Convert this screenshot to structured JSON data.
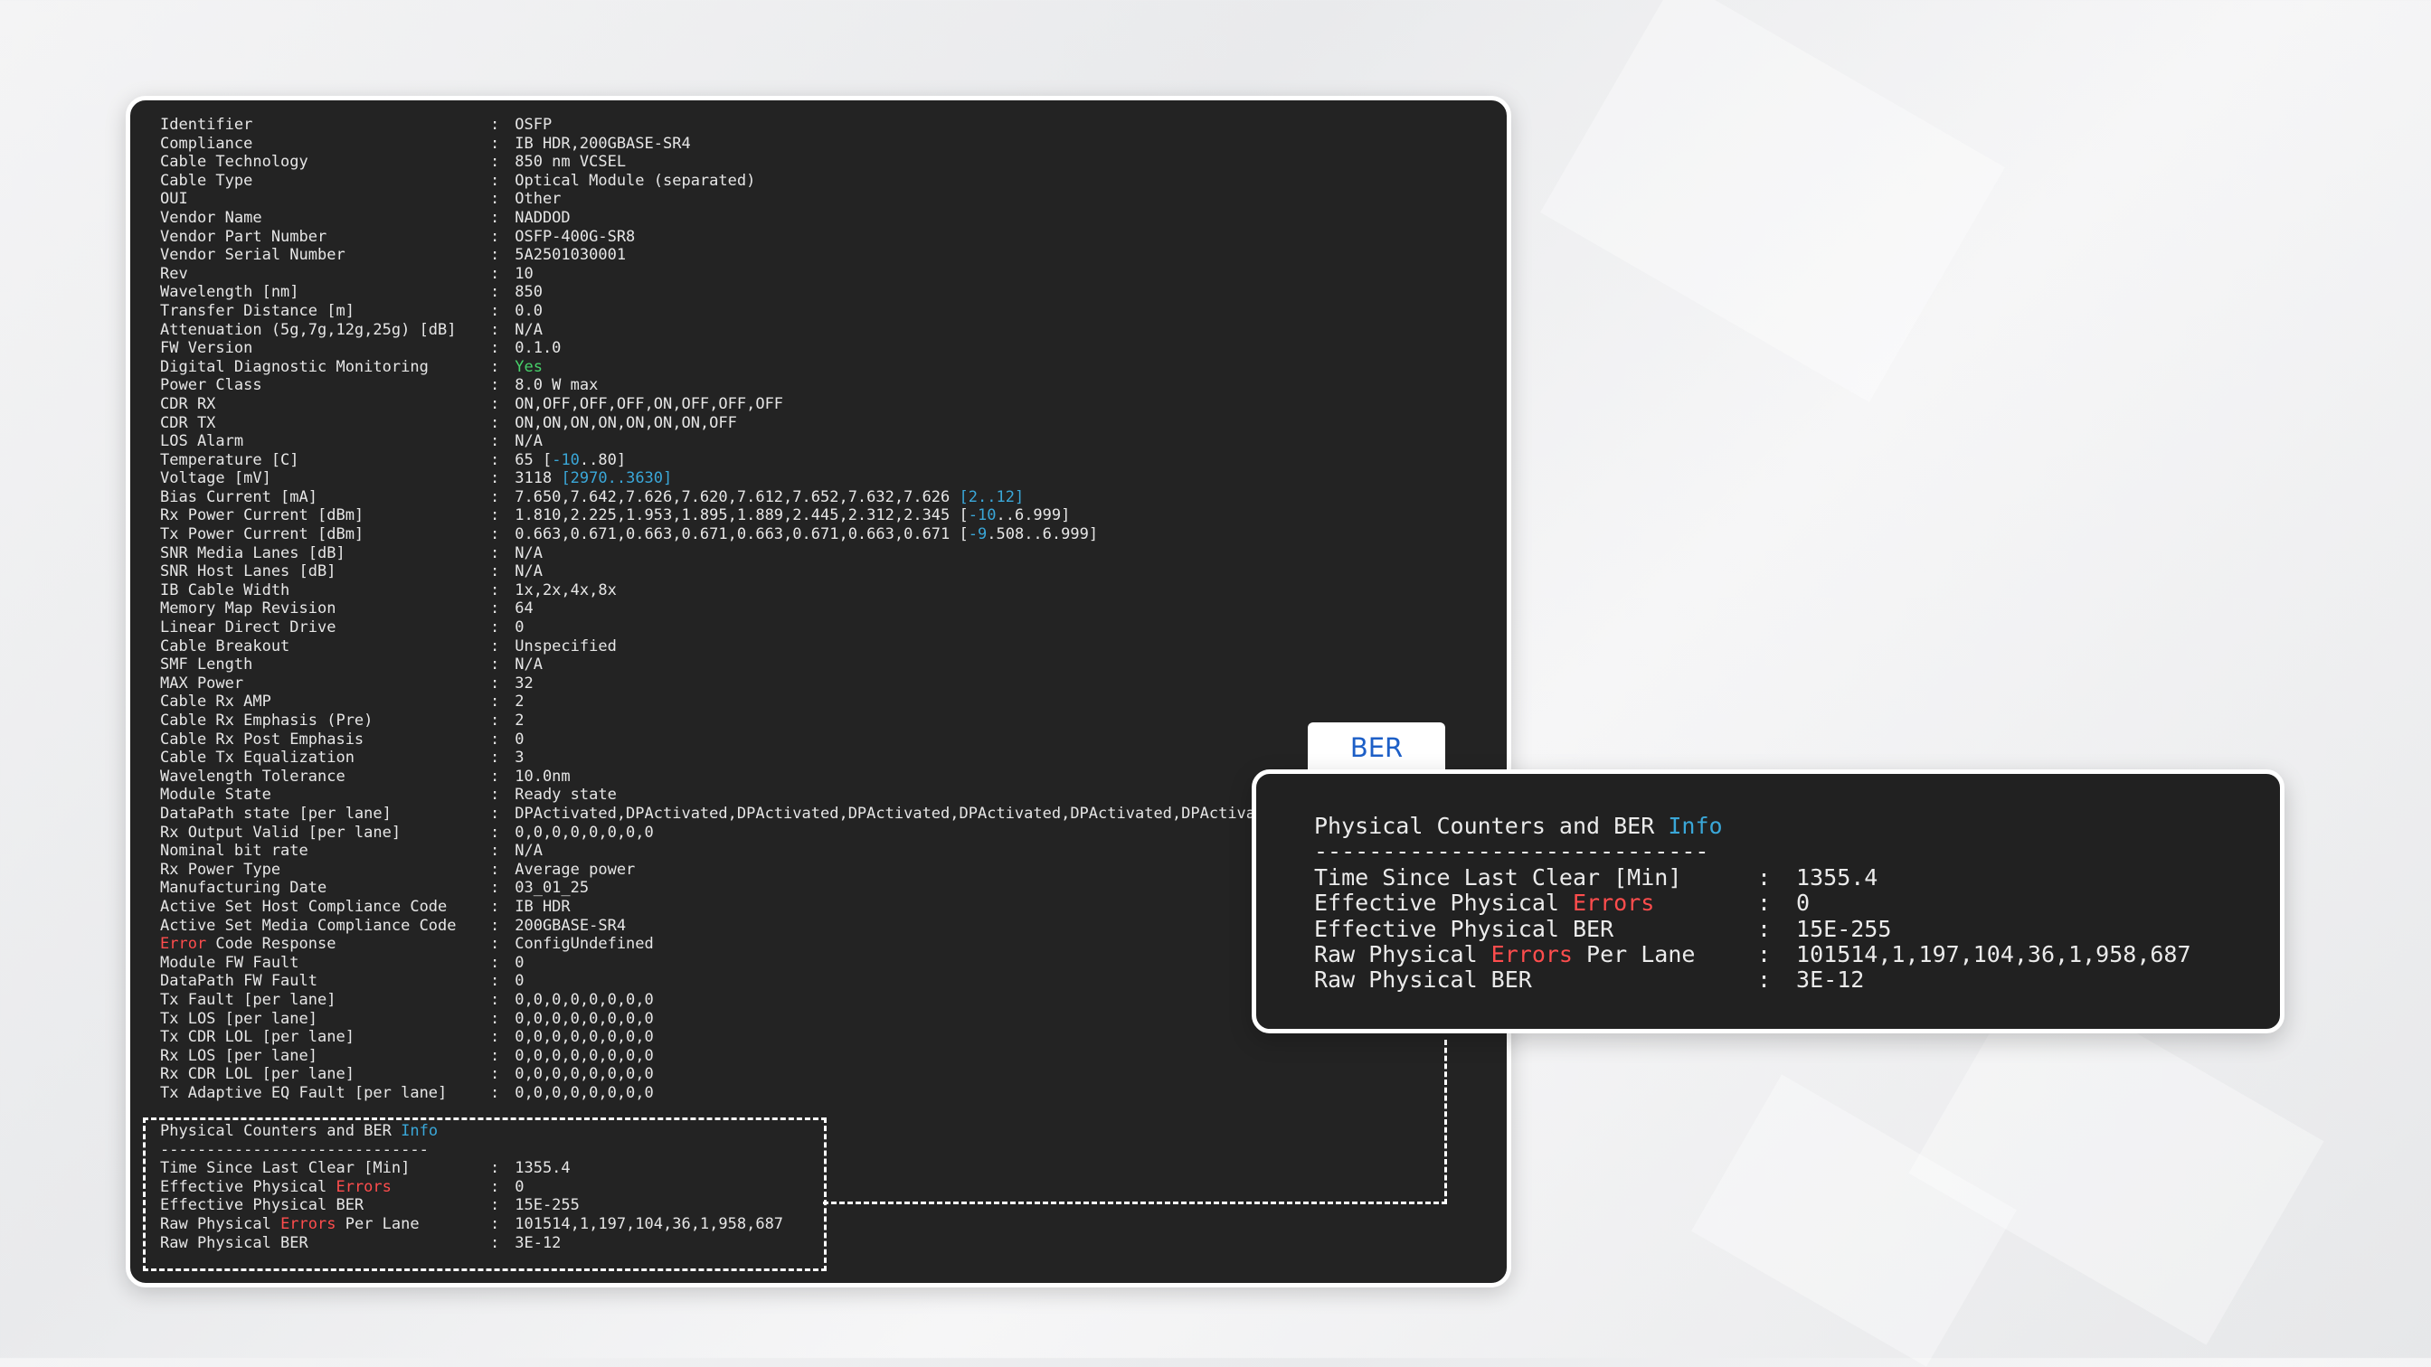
{
  "terminal": {
    "rows": [
      {
        "k": "Identifier",
        "v": "OSFP"
      },
      {
        "k": "Compliance",
        "v": "IB HDR,200GBASE-SR4"
      },
      {
        "k": "Cable Technology",
        "v": "850 nm VCSEL"
      },
      {
        "k": "Cable Type",
        "v": "Optical Module (separated)"
      },
      {
        "k": "OUI",
        "v": "Other"
      },
      {
        "k": "Vendor Name",
        "v": "NADDOD"
      },
      {
        "k": "Vendor Part Number",
        "v": "OSFP-400G-SR8"
      },
      {
        "k": "Vendor Serial Number",
        "v": "5A2501030001"
      },
      {
        "k": "Rev",
        "v": "10"
      },
      {
        "k": "Wavelength [nm]",
        "v": "850"
      },
      {
        "k": "Transfer Distance [m]",
        "v": "0.0"
      },
      {
        "k": "Attenuation (5g,7g,12g,25g) [dB]",
        "v": "N/A"
      },
      {
        "k": "FW Version",
        "v": "0.1.0"
      },
      {
        "k": "Digital Diagnostic Monitoring",
        "v": "Yes"
      },
      {
        "k": "Power Class",
        "v": "8.0 W max"
      },
      {
        "k": "CDR RX",
        "v": "ON,OFF,OFF,OFF,ON,OFF,OFF,OFF"
      },
      {
        "k": "CDR TX",
        "v": "ON,ON,ON,ON,ON,ON,ON,OFF"
      },
      {
        "k": "LOS Alarm",
        "v": "N/A"
      },
      {
        "k": "Temperature [C]",
        "v": "65",
        "r1": "[",
        "r2": "-10",
        "r3": "..80]"
      },
      {
        "k": "Voltage [mV]",
        "v": "3118",
        "rng": "[2970..3630]"
      },
      {
        "k": "Bias Current [mA]",
        "v": "7.650,7.642,7.626,7.620,7.612,7.652,7.632,7.626",
        "rng": "[2..12]"
      },
      {
        "k": "Rx Power Current [dBm]",
        "v": "1.810,2.225,1.953,1.895,1.889,2.445,2.312,2.345",
        "r1": "[",
        "r2": "-10",
        "r3": "..6.999]"
      },
      {
        "k": "Tx Power Current [dBm]",
        "v": "0.663,0.671,0.663,0.671,0.663,0.671,0.663,0.671",
        "r1": "[",
        "r2": "-9",
        "r3": ".508..6.999]"
      },
      {
        "k": "SNR Media Lanes [dB]",
        "v": "N/A"
      },
      {
        "k": "SNR Host Lanes [dB]",
        "v": "N/A"
      },
      {
        "k": "IB Cable Width",
        "v": "1x,2x,4x,8x"
      },
      {
        "k": "Memory Map Revision",
        "v": "64"
      },
      {
        "k": "Linear Direct Drive",
        "v": "0"
      },
      {
        "k": "Cable Breakout",
        "v": "Unspecified"
      },
      {
        "k": "SMF Length",
        "v": "N/A"
      },
      {
        "k": "MAX Power",
        "v": "32"
      },
      {
        "k": "Cable Rx AMP",
        "v": "2"
      },
      {
        "k": "Cable Rx Emphasis (Pre)",
        "v": "2"
      },
      {
        "k": "Cable Rx Post Emphasis",
        "v": "0"
      },
      {
        "k": "Cable Tx Equalization",
        "v": "3"
      },
      {
        "k": "Wavelength Tolerance",
        "v": "10.0nm"
      },
      {
        "k": "Module State",
        "v": "Ready state"
      },
      {
        "k": "DataPath state [per lane]",
        "v": "DPActivated,DPActivated,DPActivated,DPActivated,DPActivated,DPActivated,DPActivat"
      },
      {
        "k": "Rx Output Valid [per lane]",
        "v": "0,0,0,0,0,0,0,0"
      },
      {
        "k": "Nominal bit rate",
        "v": "N/A"
      },
      {
        "k": "Rx Power Type",
        "v": "Average power"
      },
      {
        "k": "Manufacturing Date",
        "v": "03_01_25"
      },
      {
        "k": "Active Set Host Compliance Code",
        "v": "IB HDR"
      },
      {
        "k": "Active Set Media Compliance Code",
        "v": "200GBASE-SR4"
      },
      {
        "kRed": "Error",
        "kRest": " Code Response",
        "v": "ConfigUndefined"
      },
      {
        "k": "Module FW Fault",
        "v": "0"
      },
      {
        "k": "DataPath FW Fault",
        "v": "0"
      },
      {
        "k": "Tx Fault [per lane]",
        "v": "0,0,0,0,0,0,0,0"
      },
      {
        "k": "Tx LOS [per lane]",
        "v": "0,0,0,0,0,0,0,0"
      },
      {
        "k": "Tx CDR LOL [per lane]",
        "v": "0,0,0,0,0,0,0,0"
      },
      {
        "k": "Rx LOS [per lane]",
        "v": "0,0,0,0,0,0,0,0"
      },
      {
        "k": "Rx CDR LOL [per lane]",
        "v": "0,0,0,0,0,0,0,0"
      },
      {
        "k": "Tx Adaptive EQ Fault [per lane]",
        "v": "0,0,0,0,0,0,0,0"
      }
    ],
    "separator": ":"
  },
  "ber": {
    "tab_label": "BER",
    "title_main": "Physical Counters and BER ",
    "title_info": "Info",
    "divider": "-----------------------------",
    "rows": [
      {
        "pre": "Time Since Last Clear [Min]",
        "red": "",
        "post": "",
        "v": "1355.4"
      },
      {
        "pre": "Effective Physical ",
        "red": "Errors",
        "post": "",
        "v": "0"
      },
      {
        "pre": "Effective Physical BER",
        "red": "",
        "post": "",
        "v": "15E-255"
      },
      {
        "pre": "Raw Physical ",
        "red": "Errors",
        "post": " Per Lane",
        "v": "101514,1,197,104,36,1,958,687"
      },
      {
        "pre": "Raw Physical BER",
        "red": "",
        "post": "",
        "v": "3E-12"
      }
    ]
  }
}
